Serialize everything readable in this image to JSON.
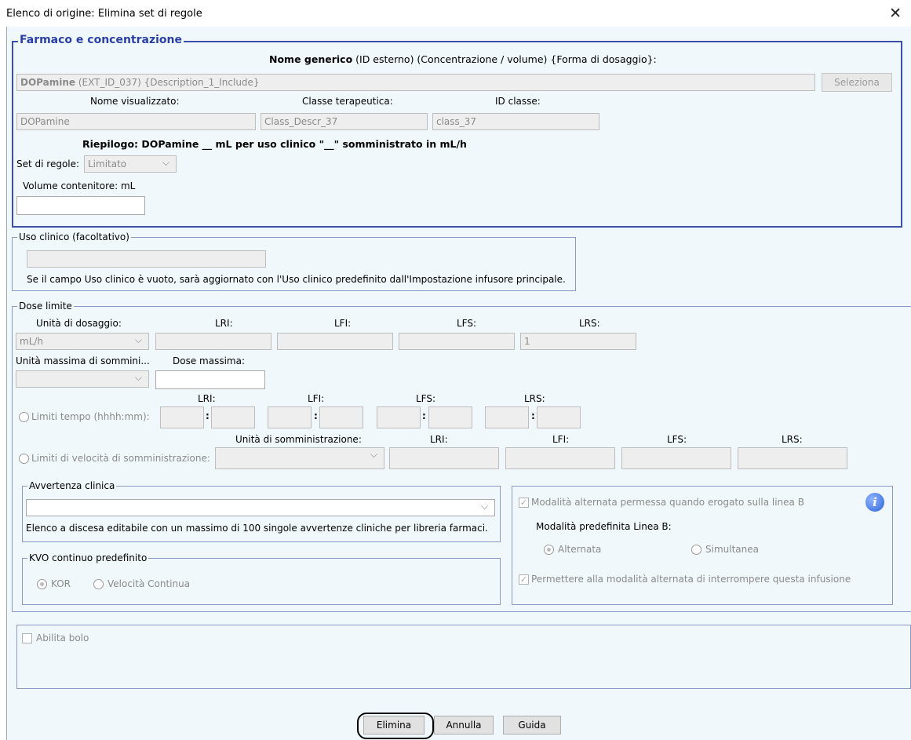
{
  "window": {
    "title": "Elenco di origine: Elimina set di regole",
    "close_glyph": "✕"
  },
  "farmaco": {
    "legend": "Farmaco e concentrazione",
    "header_bold": "Nome generico",
    "header_rest": " (ID esterno) (Concentrazione / volume) {Forma di dosaggio}:",
    "generic_name_bold": "DOPamine",
    "generic_name_rest": " (EXT_ID_037) {Description_1_Include}",
    "select_button": "Seleziona",
    "display_name_label": "Nome visualizzato:",
    "display_name_value": "DOPamine",
    "class_label": "Classe terapeutica:",
    "class_value": "Class_Descr_37",
    "class_id_label": "ID classe:",
    "class_id_value": "class_37",
    "summary": "Riepilogo: DOPamine __ mL per uso clinico \"__\" somministrato in mL/h",
    "ruleset_label": "Set di regole:",
    "ruleset_value": "Limitato",
    "container_volume_label": "Volume contenitore: mL",
    "container_volume_value": ""
  },
  "clinical_use": {
    "legend": "Uso clinico (facoltativo)",
    "value": "",
    "note": "Se il campo Uso clinico è vuoto, sarà aggiornato con l'Uso clinico predefinito dall'Impostazione infusore principale."
  },
  "dose_limits": {
    "legend": "Dose limite",
    "dosing_unit_label": "Unità di dosaggio:",
    "dosing_unit_value": "mL/h",
    "lri": "LRI:",
    "lfi": "LFI:",
    "lfs": "LFS:",
    "lrs": "LRS:",
    "lrs_value": "1",
    "max_unit_label": "Unità massima di sommini...",
    "max_dose_label": "Dose massima:",
    "time_limits_label": "Limiti tempo (hhhh:mm):",
    "rate_limits_label": "Limiti di velocità di somministrazione:",
    "admin_unit_label": "Unità di somministrazione:",
    "colon": ":"
  },
  "clinical_warning": {
    "legend": "Avvertenza clinica",
    "value": "",
    "note": "Elenco a discesa editabile con un massimo di 100 singole avvertenze cliniche per libreria farmaci."
  },
  "kvo": {
    "legend": "KVO continuo predefinito",
    "opt1": "KOR",
    "opt2": "Velocità Continua"
  },
  "line_b": {
    "alt_allowed": "Modalità alternata permessa quando erogato sulla linea B",
    "default_mode_label": "Modalità predefinita Linea B:",
    "opt_alt": "Alternata",
    "opt_sim": "Simultanea",
    "allow_interrupt": "Permettere alla modalità alternata di interrompere questa infusione",
    "info_glyph": "i"
  },
  "bolus": {
    "label": "Abilita bolo"
  },
  "buttons": {
    "delete": "Elimina",
    "cancel": "Annulla",
    "help": "Guida"
  },
  "check_glyph": "✓"
}
